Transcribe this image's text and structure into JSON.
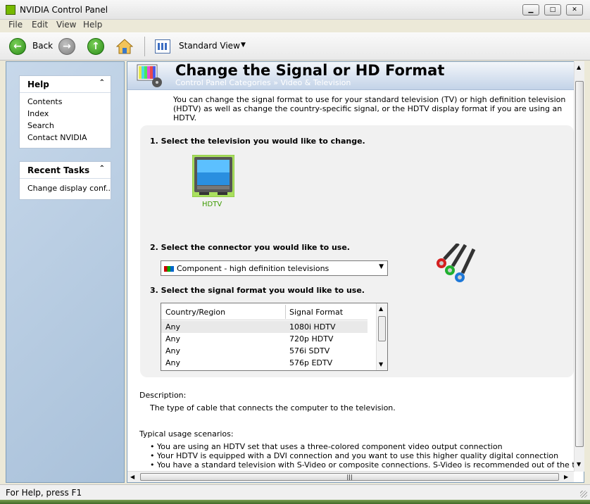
{
  "window": {
    "title": "NVIDIA Control Panel"
  },
  "menu": [
    "File",
    "Edit",
    "View",
    "Help"
  ],
  "toolbar": {
    "back_label": "Back",
    "view_label": "Standard View"
  },
  "sidebar": {
    "help": {
      "title": "Help",
      "items": [
        "Contents",
        "Index",
        "Search",
        "Contact NVIDIA"
      ]
    },
    "recent": {
      "title": "Recent Tasks",
      "items": [
        "Change display conf..."
      ]
    }
  },
  "page": {
    "title": "Change the Signal or HD Format",
    "breadcrumb": "Control Panel Categories  »  Video & Television",
    "intro": "You can change the signal format to use for your standard television (TV) or high definition television (HDTV) as well as change the country-specific signal, or the HDTV display format if you are using an HDTV.",
    "step1": "1. Select the television you would like to change.",
    "tv_label": "HDTV",
    "step2": "2. Select the connector you would like to use.",
    "connector_value": "Component - high definition televisions",
    "step3": "3. Select the signal format you would like to use.",
    "table": {
      "headers": [
        "Country/Region",
        "Signal Format"
      ],
      "rows": [
        [
          "Any",
          "1080i HDTV"
        ],
        [
          "Any",
          "720p HDTV"
        ],
        [
          "Any",
          "576i SDTV"
        ],
        [
          "Any",
          "576p EDTV"
        ]
      ]
    },
    "description_label": "Description:",
    "description_text": "The type of cable that connects the computer to the television.",
    "usage_label": "Typical usage scenarios:",
    "usage": [
      "You are using an HDTV set that uses a three-colored component video output connection",
      "Your HDTV is equipped with a DVI connection and you want to use this higher quality digital connection",
      "You have a standard television with S-Video or composite connections. S-Video is recommended out of the two because it"
    ]
  },
  "status": {
    "text": "For Help, press F1"
  },
  "colors": {
    "nvidia_green": "#76b900",
    "header_blue": "#c3d3e8"
  }
}
